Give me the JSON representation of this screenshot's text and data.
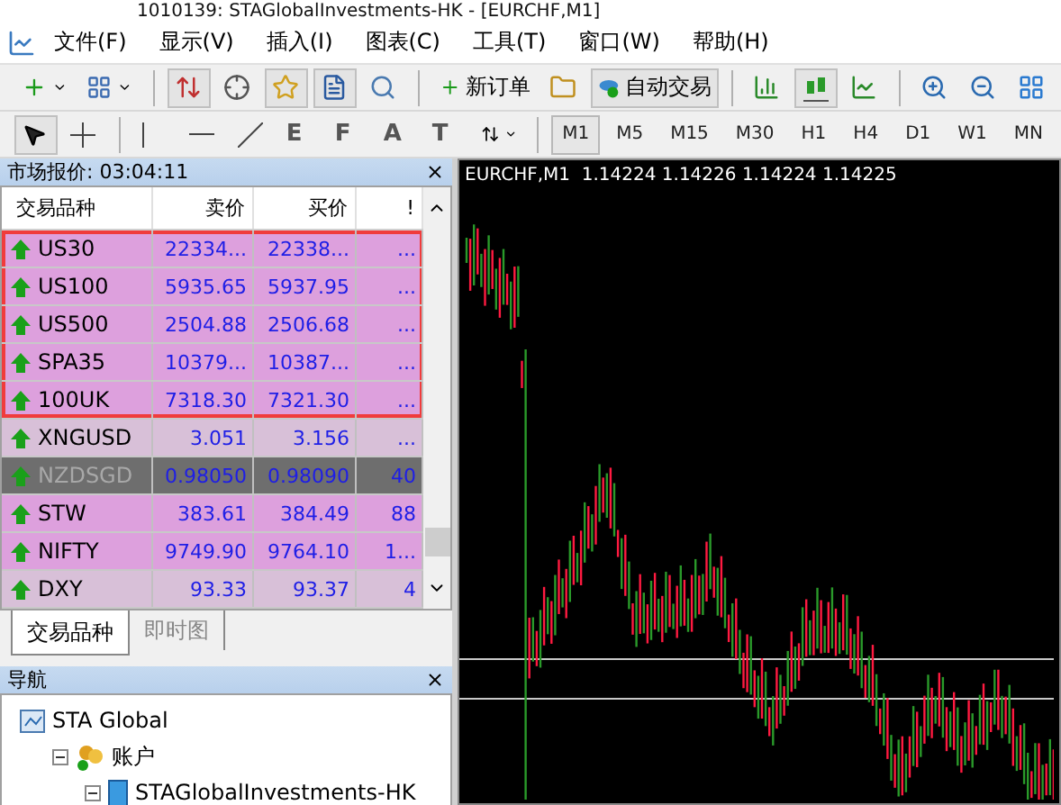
{
  "window": {
    "title": "1010139: STAGlobalInvestments-HK - [EURCHF,M1]"
  },
  "menu": [
    {
      "label": "文件(F)"
    },
    {
      "label": "显示(V)"
    },
    {
      "label": "插入(I)"
    },
    {
      "label": "图表(C)"
    },
    {
      "label": "工具(T)"
    },
    {
      "label": "窗口(W)"
    },
    {
      "label": "帮助(H)"
    }
  ],
  "toolbar": [
    {
      "kind": "new-chart",
      "selected": false
    },
    {
      "kind": "profiles",
      "selected": false
    },
    {
      "kind": "sep"
    },
    {
      "kind": "market-watch",
      "selected": true
    },
    {
      "kind": "data-window",
      "selected": false
    },
    {
      "kind": "navigator",
      "selected": true
    },
    {
      "kind": "terminal",
      "selected": true
    },
    {
      "kind": "tester",
      "selected": false
    },
    {
      "kind": "sep"
    },
    {
      "kind": "new-order",
      "label": "新订单",
      "selected": false
    },
    {
      "kind": "editor",
      "selected": false
    },
    {
      "kind": "auto-trading",
      "label": "自动交易",
      "selected": true
    },
    {
      "kind": "sep"
    },
    {
      "kind": "bars",
      "selected": false
    },
    {
      "kind": "candles",
      "selected": true
    },
    {
      "kind": "line",
      "selected": false
    },
    {
      "kind": "sep"
    },
    {
      "kind": "zoom-in",
      "selected": false
    },
    {
      "kind": "zoom-out",
      "selected": false
    },
    {
      "kind": "tile",
      "selected": false
    }
  ],
  "tools": [
    {
      "kind": "cursor",
      "selected": true
    },
    {
      "kind": "crosshair",
      "selected": false
    },
    {
      "kind": "sep"
    },
    {
      "kind": "vline",
      "selected": false
    },
    {
      "kind": "hline",
      "selected": false
    },
    {
      "kind": "trend",
      "selected": false
    },
    {
      "kind": "channel",
      "glyph": "E",
      "selected": false
    },
    {
      "kind": "fibo",
      "glyph": "F",
      "selected": false
    },
    {
      "kind": "text",
      "glyph": "A",
      "selected": false
    },
    {
      "kind": "label",
      "glyph": "T",
      "selected": false
    },
    {
      "kind": "arrows",
      "selected": false
    },
    {
      "kind": "sep"
    }
  ],
  "timeframes": [
    {
      "label": "M1",
      "selected": true
    },
    {
      "label": "M5",
      "selected": false
    },
    {
      "label": "M15",
      "selected": false
    },
    {
      "label": "M30",
      "selected": false
    },
    {
      "label": "H1",
      "selected": false
    },
    {
      "label": "H4",
      "selected": false
    },
    {
      "label": "D1",
      "selected": false
    },
    {
      "label": "W1",
      "selected": false
    },
    {
      "label": "MN",
      "selected": false
    }
  ],
  "market_watch": {
    "title": "市场报价: 03:04:11",
    "columns": [
      "交易品种",
      "卖价",
      "买价",
      "!"
    ],
    "rows": [
      {
        "symbol": "US30",
        "bid": "22334...",
        "ask": "22338...",
        "spread": "...",
        "color": "#dda0dd",
        "disabled": false,
        "framed": true
      },
      {
        "symbol": "US100",
        "bid": "5935.65",
        "ask": "5937.95",
        "spread": "...",
        "color": "#dda0dd",
        "disabled": false,
        "framed": true
      },
      {
        "symbol": "US500",
        "bid": "2504.88",
        "ask": "2506.68",
        "spread": "...",
        "color": "#dda0dd",
        "disabled": false,
        "framed": true
      },
      {
        "symbol": "SPA35",
        "bid": "10379...",
        "ask": "10387...",
        "spread": "...",
        "color": "#dda0dd",
        "disabled": false,
        "framed": true
      },
      {
        "symbol": "100UK",
        "bid": "7318.30",
        "ask": "7321.30",
        "spread": "...",
        "color": "#dda0dd",
        "disabled": false,
        "framed": true
      },
      {
        "symbol": "XNGUSD",
        "bid": "3.051",
        "ask": "3.156",
        "spread": "...",
        "color": "#d8c0d8",
        "disabled": false,
        "framed": false
      },
      {
        "symbol": "NZDSGD",
        "bid": "0.98050",
        "ask": "0.98090",
        "spread": "40",
        "color": "#6e6e6e",
        "disabled": true,
        "framed": false
      },
      {
        "symbol": "STW",
        "bid": "383.61",
        "ask": "384.49",
        "spread": "88",
        "color": "#dda0dd",
        "disabled": false,
        "framed": false
      },
      {
        "symbol": "NIFTY",
        "bid": "9749.90",
        "ask": "9764.10",
        "spread": "1...",
        "color": "#dda0dd",
        "disabled": false,
        "framed": false
      },
      {
        "symbol": "DXY",
        "bid": "93.33",
        "ask": "93.37",
        "spread": "4",
        "color": "#d8c0d8",
        "disabled": false,
        "framed": false
      }
    ],
    "tabs": [
      {
        "label": "交易品种",
        "selected": true
      },
      {
        "label": "即时图",
        "selected": false
      }
    ]
  },
  "navigator": {
    "title": "导航",
    "tree": [
      {
        "label": "STA Global",
        "kind": "terminal",
        "children": [
          {
            "label": "账户",
            "kind": "accounts",
            "expanded": true,
            "children": [
              {
                "label": "STAGlobalInvestments-HK",
                "kind": "server",
                "expanded": true
              }
            ]
          }
        ]
      }
    ]
  },
  "chart": {
    "title": "EURCHF,M1",
    "quote": "1.14224 1.14226 1.14224 1.14225"
  }
}
